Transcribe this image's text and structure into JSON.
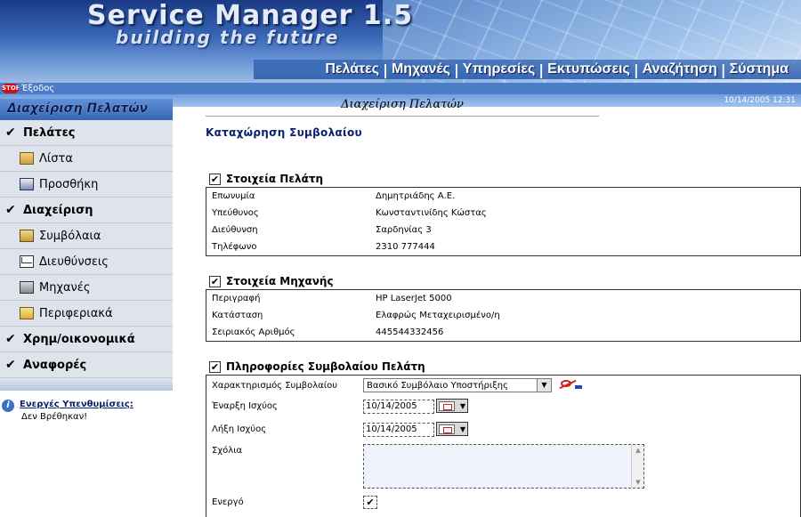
{
  "header": {
    "title": "Service Manager 1.5",
    "subtitle": "building the future",
    "menu": [
      "Πελάτες",
      "Μηχανές",
      "Υπηρεσίες",
      "Εκτυπώσεις",
      "Αναζήτηση",
      "Σύστημα"
    ],
    "exit_label": "Έξοδος",
    "stop_text": "STOP",
    "datetime": "10/14/2005 12:31"
  },
  "sidebar": {
    "title": "Διαχείριση Πελατών",
    "sections": [
      {
        "label": "Πελάτες",
        "items": [
          {
            "label": "Λίστα",
            "icon": "list-icon"
          },
          {
            "label": "Προσθήκη",
            "icon": "add-icon"
          }
        ]
      },
      {
        "label": "Διαχείριση",
        "items": [
          {
            "label": "Συμβόλαια",
            "icon": "contract-icon"
          },
          {
            "label": "Διευθύνσεις",
            "icon": "envelope-icon"
          },
          {
            "label": "Μηχανές",
            "icon": "printer-icon"
          },
          {
            "label": "Περιφεριακά",
            "icon": "folder-icon"
          }
        ]
      },
      {
        "label": "Χρημ/οικονομικά",
        "items": []
      },
      {
        "label": "Αναφορές",
        "items": []
      }
    ],
    "reminders": {
      "title": "Ενεργές Υπενθυμίσεις:",
      "value": "Δεν Βρέθηκαν!"
    }
  },
  "main": {
    "page_title": "Διαχείριση Πελατών",
    "form_title": "Καταχώρηση Συμβολαίου",
    "customer": {
      "title": "Στοιχεία Πελάτη",
      "rows": [
        {
          "label": "Επωνυμία",
          "value": "Δημητριάδης Α.Ε."
        },
        {
          "label": "Υπεύθυνος",
          "value": "Κωνσταντινίδης Κώστας"
        },
        {
          "label": "Διεύθυνση",
          "value": "Σαρδηνίας 3"
        },
        {
          "label": "Τηλέφωνο",
          "value": "2310 777444"
        }
      ]
    },
    "machine": {
      "title": "Στοιχεία Μηχανής",
      "rows": [
        {
          "label": "Περιγραφή",
          "value": "HP LaserJet 5000"
        },
        {
          "label": "Κατάσταση",
          "value": "Ελαφρώς Μεταχειρισμένο/η"
        },
        {
          "label": "Σειριακός Αριθμός",
          "value": "445544332456"
        }
      ]
    },
    "contract": {
      "title": "Πληροφορίες Συμβολαίου Πελάτη",
      "type_label": "Χαρακτηρισμός Συμβολαίου",
      "type_value": "Βασικό Συμβόλαιο Υποστήριξης",
      "start_label": "Έναρξη Ισχύος",
      "start_value": "10/14/2005",
      "end_label": "Λήξη Ισχύος",
      "end_value": "10/14/2005",
      "comments_label": "Σχόλια",
      "comments_value": "",
      "active_label": "Ενεργό",
      "active_checked": true
    }
  }
}
